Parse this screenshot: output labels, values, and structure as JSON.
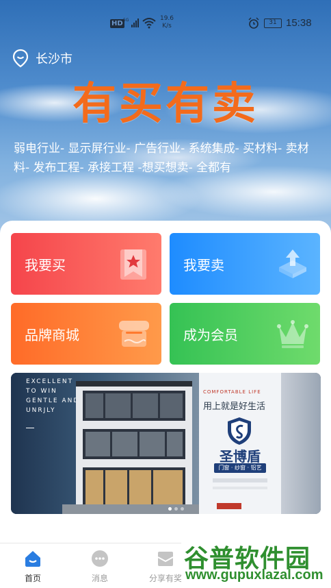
{
  "status_bar": {
    "hd": "HD",
    "network": "5G",
    "speed_value": "19.6",
    "speed_unit": "K/s",
    "battery": "31",
    "time": "15:38"
  },
  "header": {
    "location": "长沙市",
    "title": "有买有卖",
    "description": "弱电行业- 显示屏行业- 广告行业- 系统集成- 买材料- 卖材料- 发布工程- 承接工程 -想买想卖- 全都有"
  },
  "tiles": {
    "buy": "我要买",
    "sell": "我要卖",
    "mall": "品牌商城",
    "member": "成为会员"
  },
  "banner": {
    "en_line1": "EXCELLENT",
    "en_line2": "TO WIN",
    "en_line3": "GENTLE AND",
    "en_line4": "UNRJLY",
    "comfort": "COMFORTABLE LIFE",
    "slogan": "用上就是好生活",
    "brand": "圣博盾",
    "brand_sub": "门窗 · 纱窗 · 铝艺"
  },
  "tabbar": {
    "home": "首页",
    "messages": "消息",
    "share": "分享有奖"
  },
  "watermark": {
    "name": "谷普软件园",
    "url": "www.gupuxlazal.com"
  },
  "colors": {
    "title_orange": "#f36b1c",
    "buy_red": "#f5454b",
    "sell_blue": "#1e8cff",
    "mall_orange": "#ff6b28",
    "member_green": "#35c254",
    "tab_active": "#2a7de1"
  }
}
